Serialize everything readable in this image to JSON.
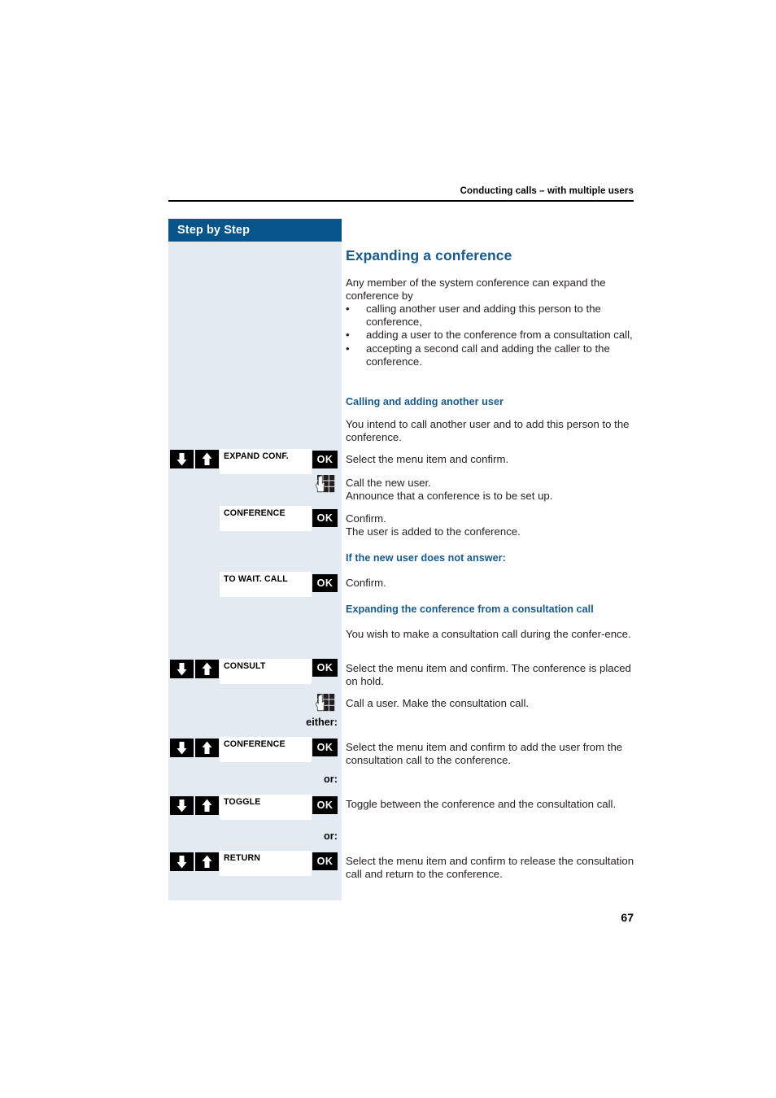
{
  "header": {
    "running_head": "Conducting calls – with multiple users"
  },
  "sidebar": {
    "title": "Step by Step"
  },
  "page": {
    "number": "67"
  },
  "content": {
    "title": "Expanding a conference",
    "intro": "Any member of the system conference can expand the conference by",
    "bullet_glyph": "•",
    "bullets": [
      "calling another user and adding this person to the conference,",
      "adding a user to the conference from a consultation call,",
      "accepting a second call and adding the caller to the conference."
    ],
    "section_1_heading": "Calling and adding another user",
    "section_1_intro": "You intend to call another user and to add this person to the conference.",
    "section_2_heading": "If the new user does not answer:",
    "section_3_heading": "Expanding the conference from a consultation call",
    "section_3_intro": "You wish to make a consultation call during the confer-ence.",
    "either_label": "either:",
    "or_label_1": "or:",
    "or_label_2": "or:"
  },
  "steps": [
    {
      "menu_label": "EXPAND CONF.",
      "ok_label": "OK",
      "description": "Select the menu item and confirm.",
      "has_arrows": true
    },
    {
      "keypad_icon": "keypad-dial-icon",
      "description_line_1": "Call the new user.",
      "description_line_2": "Announce that a conference is to be set up."
    },
    {
      "menu_label": "CONFERENCE",
      "ok_label": "OK",
      "description_line_1": "Confirm.",
      "description_line_2": "The user is added to the conference.",
      "has_arrows": false
    },
    {
      "menu_label": "TO WAIT. CALL",
      "ok_label": "OK",
      "description": "Confirm.",
      "has_arrows": false
    },
    {
      "menu_label": "CONSULT",
      "ok_label": "OK",
      "description": "Select the menu item and confirm. The conference is placed on hold.",
      "has_arrows": true
    },
    {
      "keypad_icon": "keypad-dial-icon",
      "description": "Call a user. Make the consultation call."
    },
    {
      "menu_label": "CONFERENCE",
      "ok_label": "OK",
      "description": "Select the menu item and confirm to add the user from the consultation call to the conference.",
      "has_arrows": true
    },
    {
      "menu_label": "TOGGLE",
      "ok_label": "OK",
      "description": "Toggle between the conference and the consultation call.",
      "has_arrows": true
    },
    {
      "menu_label": "RETURN",
      "ok_label": "OK",
      "description": "Select the menu item and confirm to release the consultation call and return to the conference.",
      "has_arrows": true
    }
  ],
  "colors": {
    "brand_blue": "#07548b",
    "heading_blue": "#165a8c",
    "panel_bg": "#e3eaf2",
    "ink": "#231f20"
  }
}
